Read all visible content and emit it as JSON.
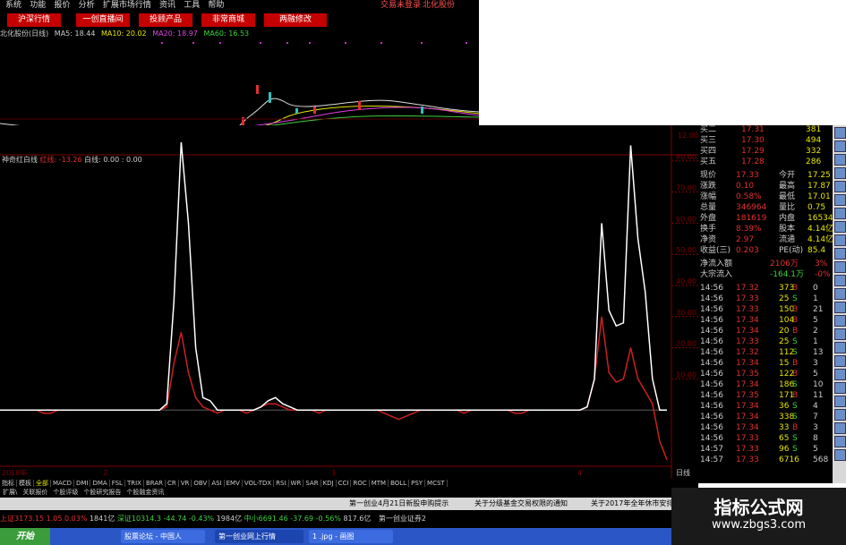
{
  "menu": [
    "系统",
    "功能",
    "报价",
    "分析",
    "扩展市场行情",
    "资讯",
    "工具",
    "帮助"
  ],
  "topright": {
    "status": "交易未登录",
    "stock": "北化股份"
  },
  "tabs": [
    "沪深行情",
    "一创直播间",
    "投顾产品",
    "非常商城",
    "两融修改"
  ],
  "chart_header": {
    "name": "北化股份(日线)",
    "ma5": "MA5: 18.44",
    "ma10": "MA10: 20.02",
    "ma20": "MA20: 18.97",
    "ma60": "MA60: 16.53"
  },
  "price_tick": "12.00",
  "indicator_header": {
    "name": "神奇红白线",
    "red": "红线: -13.26",
    "white": "白线: 0.00 : 0.00"
  },
  "y_ticks": [
    "80.00",
    "70.00",
    "60.00",
    "50.00",
    "40.00",
    "30.00",
    "20.00",
    "10.00"
  ],
  "x_labels": {
    "year": "2018年",
    "m2": "2",
    "m3": "3",
    "m4": "4",
    "right": "日线"
  },
  "chart_data": {
    "type": "line",
    "ylim": [
      -10,
      90
    ],
    "series": [
      {
        "name": "白线",
        "color": "#ffffff",
        "values": [
          0,
          0,
          0,
          0,
          0,
          0,
          0,
          0,
          0,
          0,
          0,
          0,
          0,
          0,
          0,
          0,
          0,
          0,
          0,
          0,
          0,
          0,
          0,
          2,
          35,
          86,
          60,
          20,
          4,
          3,
          0,
          0,
          0,
          0,
          0,
          0,
          1,
          3,
          4,
          2,
          1,
          0,
          0,
          0,
          0,
          0,
          0,
          0,
          0,
          0,
          0,
          0,
          0,
          0,
          0,
          0,
          0,
          0,
          0,
          0,
          0,
          0,
          0,
          0,
          0,
          0,
          0,
          0,
          0,
          0,
          0,
          0,
          0,
          0,
          0,
          0,
          0,
          0,
          0,
          0,
          0,
          1,
          10,
          60,
          32,
          27,
          28,
          85,
          55,
          38,
          10,
          0,
          0
        ]
      },
      {
        "name": "红线",
        "color": "#cc2020",
        "values": [
          0,
          0,
          0,
          0,
          0,
          0,
          -1,
          -1,
          0,
          0,
          0,
          0,
          0,
          0,
          0,
          0,
          0,
          0,
          0,
          0,
          0,
          0,
          0,
          1,
          15,
          25,
          12,
          4,
          1,
          0,
          -1,
          0,
          0,
          0,
          -1,
          0,
          1,
          2,
          2,
          1,
          0,
          0,
          0,
          0,
          -1,
          0,
          0,
          0,
          0,
          0,
          0,
          0,
          0,
          -1,
          -2,
          -3,
          -2,
          -1,
          0,
          0,
          0,
          0,
          0,
          0,
          -1,
          0,
          0,
          0,
          0,
          0,
          0,
          -1,
          -1,
          0,
          0,
          0,
          0,
          0,
          0,
          0,
          0,
          1,
          10,
          30,
          12,
          9,
          10,
          20,
          10,
          6,
          2,
          -10,
          -16
        ]
      }
    ]
  },
  "quote": {
    "bids": [
      [
        "买二",
        "17.31",
        "381"
      ],
      [
        "买三",
        "17.30",
        "494"
      ],
      [
        "买四",
        "17.29",
        "332"
      ],
      [
        "买五",
        "17.28",
        "286"
      ]
    ],
    "stats": [
      [
        "现价",
        "17.33",
        "今开",
        "17.25"
      ],
      [
        "涨跌",
        "0.10",
        "最高",
        "17.87"
      ],
      [
        "涨幅",
        "0.58%",
        "最低",
        "17.01"
      ],
      [
        "总量",
        "346964",
        "量比",
        "0.75"
      ],
      [
        "外盘",
        "181619",
        "内盘",
        "165345"
      ],
      [
        "换手",
        "8.39%",
        "股本",
        "4.14亿"
      ],
      [
        "净资",
        "2.97",
        "流通",
        "4.14亿"
      ],
      [
        "收益(三)",
        "0.203",
        "PE(动)",
        "85.4"
      ]
    ],
    "flows": [
      [
        "净流入额",
        "2106万",
        "3%"
      ],
      [
        "大宗流入",
        "-164.1万",
        "-0%"
      ]
    ],
    "trades": [
      [
        "14:56",
        "17.32",
        "373",
        "B",
        "0"
      ],
      [
        "14:56",
        "17.33",
        "25",
        "S",
        "1"
      ],
      [
        "14:56",
        "17.33",
        "150",
        "B",
        "21"
      ],
      [
        "14:56",
        "17.34",
        "104",
        "B",
        "5"
      ],
      [
        "14:56",
        "17.34",
        "20",
        "B",
        "2"
      ],
      [
        "14:56",
        "17.33",
        "25",
        "S",
        "1"
      ],
      [
        "14:56",
        "17.32",
        "112",
        "S",
        "13"
      ],
      [
        "14:56",
        "17.34",
        "15",
        "B",
        "3"
      ],
      [
        "14:56",
        "17.35",
        "122",
        "B",
        "5"
      ],
      [
        "14:56",
        "17.34",
        "186",
        "S",
        "10"
      ],
      [
        "14:56",
        "17.35",
        "171",
        "B",
        "11"
      ],
      [
        "14:56",
        "17.34",
        "36",
        "S",
        "4"
      ],
      [
        "14:56",
        "17.34",
        "338",
        "S",
        "7"
      ],
      [
        "14:56",
        "17.34",
        "33",
        "B",
        "3"
      ],
      [
        "14:56",
        "17.33",
        "65",
        "S",
        "8"
      ],
      [
        "14:57",
        "17.33",
        "96",
        "S",
        "5"
      ],
      [
        "14:57",
        "17.33",
        "6716",
        "",
        "568"
      ]
    ]
  },
  "indicator_tabs": [
    "指标",
    "模板",
    "全部",
    "MACD",
    "DMI",
    "DMA",
    "FSL",
    "TRIX",
    "BRAR",
    "CR",
    "VR",
    "OBV",
    "ASI",
    "EMV",
    "VOL-TDX",
    "RSI",
    "WR",
    "SAR",
    "KDJ",
    "CCI",
    "ROC",
    "MTM",
    "BOLL",
    "PSY",
    "MCST"
  ],
  "sub_tabs": [
    "扩展\\",
    "关联报价",
    "个股评级",
    "个股研究报告",
    "个股融金资讯"
  ],
  "ticker": [
    "第一创业4月21日新股申购提示",
    "关于分级基金交易权限的通知",
    "关于2017年全年休市安排的"
  ],
  "status": {
    "sh": "上证3173.15",
    "sh_chg": "1.05",
    "sh_pct": "0.03%",
    "sh_vol": "1841亿",
    "sz": "深证10314.3",
    "sz_chg": "-44.74",
    "sz_pct": "-0.43%",
    "sz_vol": "1984亿",
    "zx": "中小6691.46",
    "zx_chg": "-37.69",
    "zx_pct": "-0.56%",
    "zx_vol": "817.6亿",
    "broker": "第一创业证券2"
  },
  "taskbar": {
    "start": "开始",
    "items": [
      "股票论坛 - 中国人",
      "第一创业网上行情",
      "1 .jpg - 画图"
    ]
  },
  "watermark": {
    "title": "指标公式网",
    "url": "www.zbgs3.com"
  }
}
